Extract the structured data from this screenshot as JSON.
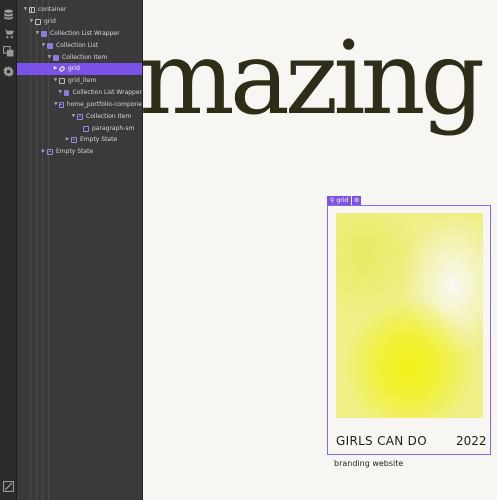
{
  "rail": {
    "icons": [
      "database-icon",
      "cart-icon",
      "pages-icon",
      "settings-icon",
      "collapse-icon"
    ]
  },
  "navigator": {
    "items": [
      {
        "label": "container",
        "icon": "container"
      },
      {
        "label": "grid",
        "icon": "box"
      },
      {
        "label": "Collection List Wrapper",
        "icon": "db"
      },
      {
        "label": "Collection List",
        "icon": "db"
      },
      {
        "label": "Collection Item",
        "icon": "db"
      },
      {
        "label": "grid",
        "icon": "link",
        "selected": true
      },
      {
        "label": "grid_item",
        "icon": "box"
      },
      {
        "label": "Collection List Wrapper",
        "icon": "db"
      },
      {
        "label": "home_portfolio-compone",
        "icon": "list"
      },
      {
        "label": "Collection Item",
        "icon": "list"
      },
      {
        "label": "paragraph-sm",
        "icon": "para"
      },
      {
        "label": "Empty State",
        "icon": "list"
      },
      {
        "label": "Empty State",
        "icon": "list"
      }
    ]
  },
  "canvas": {
    "headline": "mazing c",
    "selection_tag": "grid",
    "card": {
      "title": "GIRLS CAN DO",
      "year": "2022",
      "subtitle": "branding website"
    }
  },
  "colors": {
    "accent": "#7b52e8",
    "headline": "#2f2d17",
    "panel": "#3a3a3a",
    "canvas": "#f7f6f3"
  }
}
